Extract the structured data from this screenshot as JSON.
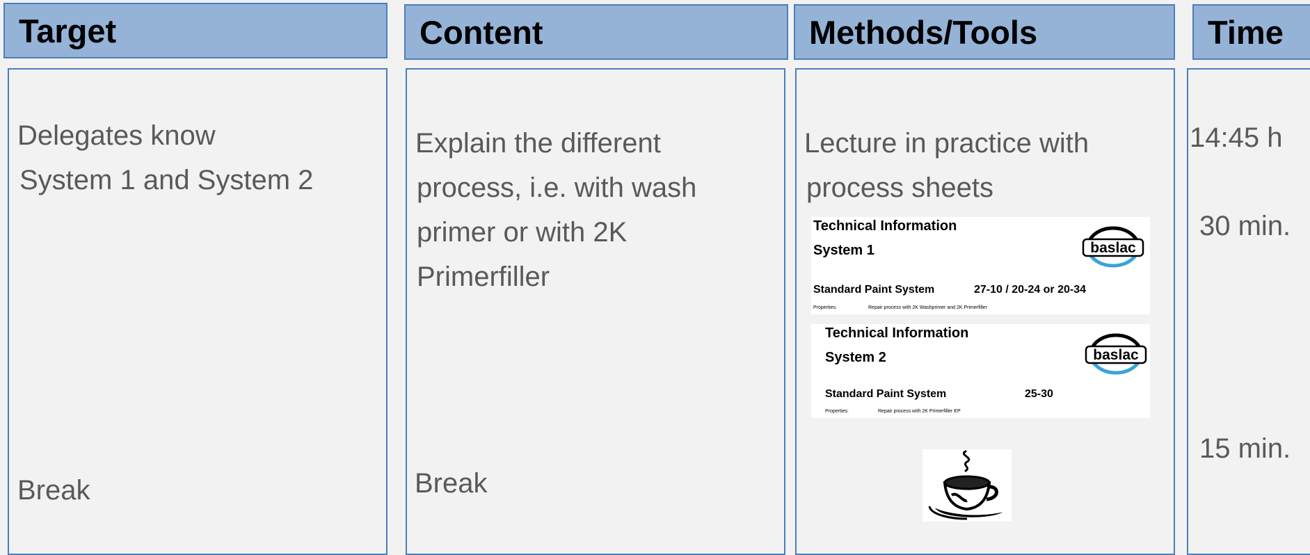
{
  "headers": {
    "target": "Target",
    "content": "Content",
    "methods": "Methods/Tools",
    "time": "Time"
  },
  "target": {
    "line1": "Delegates know",
    "line2": "System 1 and System 2",
    "break": "Break"
  },
  "content": {
    "lines": [
      "Explain the different",
      "process, i.e. with wash",
      "primer or with 2K",
      "Primerfiller"
    ],
    "break": "Break"
  },
  "methods": {
    "lines": [
      "Lecture in practice with",
      "process sheets"
    ],
    "cards": [
      {
        "heading": "Technical Information",
        "system": "System 1",
        "standard": "Standard Paint System",
        "codes": "27-10 / 20-24 or 20-34",
        "props_label": "Properties:",
        "props_text": "Repair process with 2K Washprimer and 2K Primerfiller",
        "logo_text": "baslac"
      },
      {
        "heading": "Technical Information",
        "system": "System 2",
        "standard": "Standard Paint System",
        "codes": "25-30",
        "props_label": "Properties:",
        "props_text": "Repair process with 2K Primerfiller EP",
        "logo_text": "baslac"
      }
    ],
    "coffee_icon": "coffee-cup-icon"
  },
  "time": {
    "start": "14:45 h",
    "duration1": "30 min.",
    "duration2": "15 min."
  },
  "colors": {
    "header_fill": "#95b3d7",
    "border": "#4a7ebb",
    "background": "#f2f2f2",
    "body_text": "#595959",
    "logo_accent": "#3aa3d8"
  }
}
